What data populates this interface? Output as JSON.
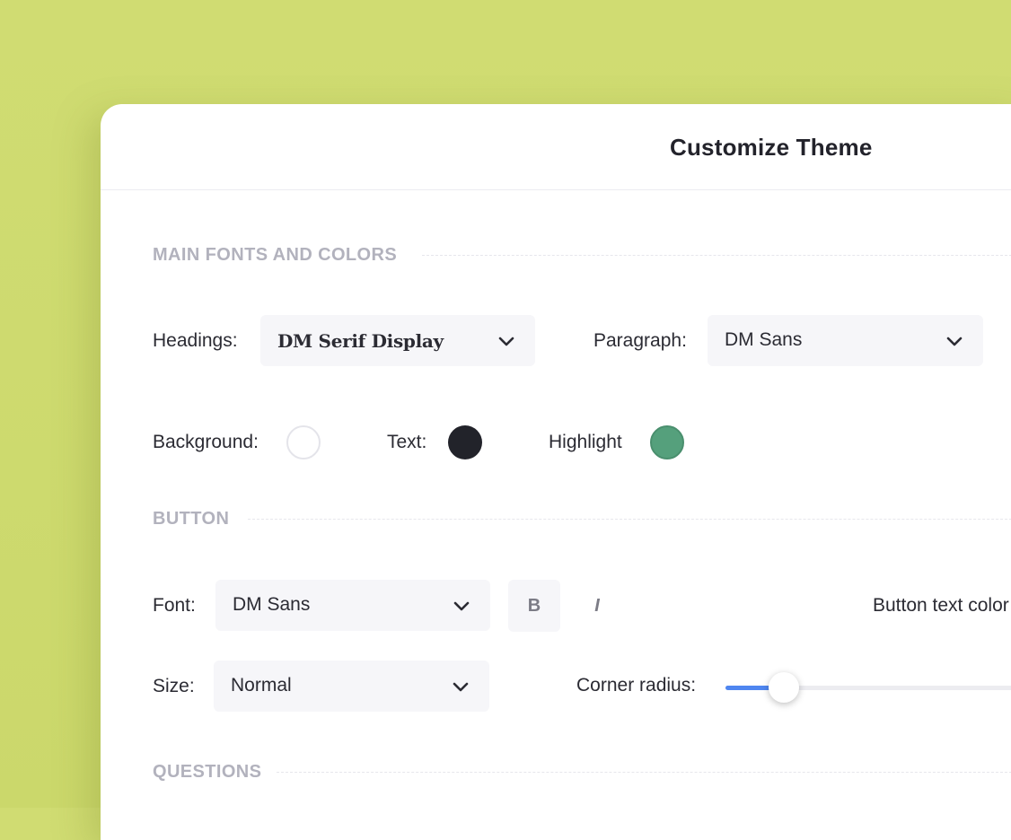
{
  "panel": {
    "title": "Customize Theme"
  },
  "sections": {
    "main": "MAIN FONTS AND COLORS",
    "button": "BUTTON",
    "questions": "QUESTIONS"
  },
  "fonts": {
    "headings_label": "Headings:",
    "headings_value": "DM Serif Display",
    "paragraph_label": "Paragraph:",
    "paragraph_value": "DM Sans"
  },
  "colors": {
    "background_label": "Background:",
    "background_color": "#ffffff",
    "text_label": "Text:",
    "text_color": "#22232a",
    "highlight_label": "Highlight",
    "highlight_color": "#55a07c"
  },
  "button": {
    "font_label": "Font:",
    "font_value": "DM Sans",
    "bold_label": "B",
    "italic_label": "I",
    "text_color_label": "Button text color",
    "size_label": "Size:",
    "size_value": "Normal",
    "corner_radius_label": "Corner radius:",
    "corner_radius_level": 0.18,
    "slider_accent": "#4f86f0"
  }
}
